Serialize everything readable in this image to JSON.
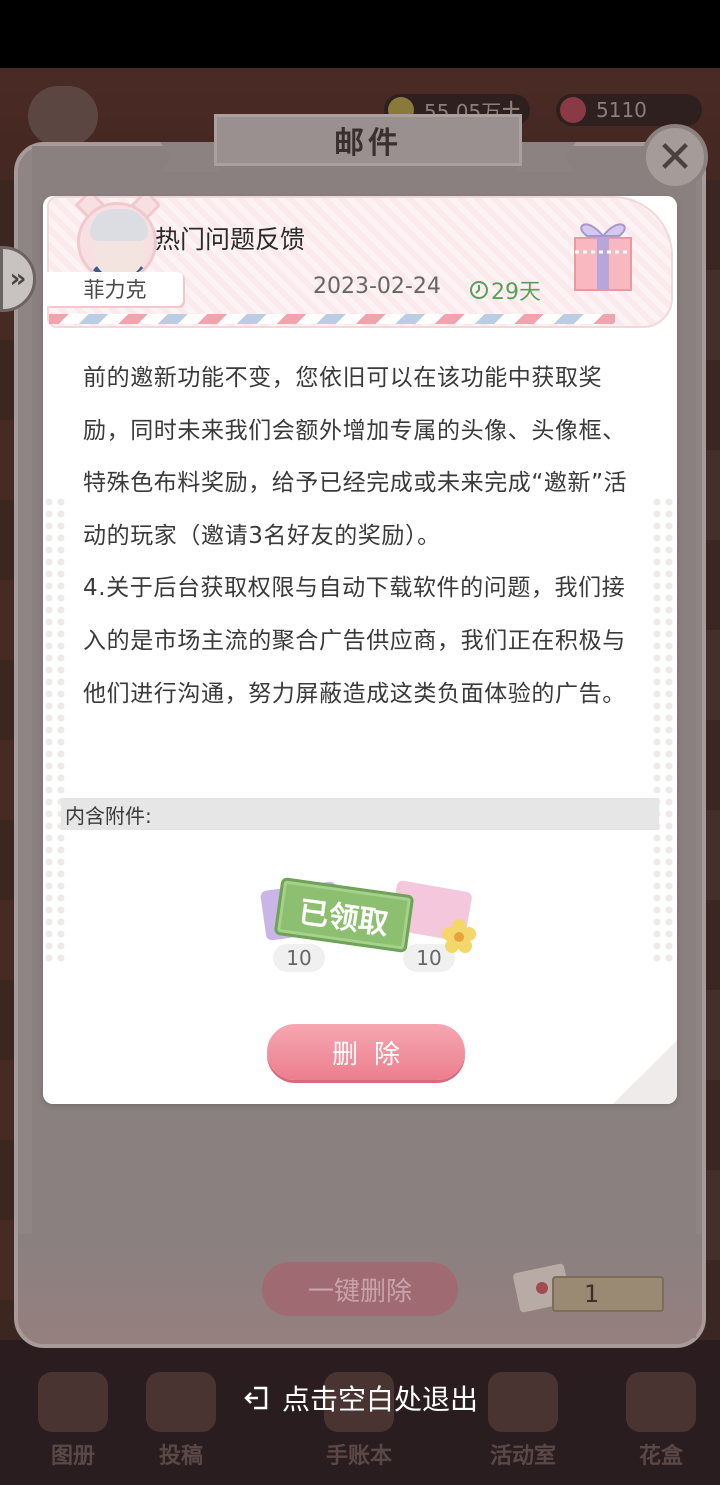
{
  "hud": {
    "currency_1": "55.05万",
    "currency_2": "5110"
  },
  "mail_window": {
    "title": "邮件",
    "close_symbol": "✕",
    "side_tab_symbol": "»",
    "delete_all_label": "一键删除",
    "mail_count": "1"
  },
  "mail": {
    "sender": "菲力克",
    "subject": "热门问题反馈",
    "date": "2023-02-24",
    "expires_in": "29天",
    "body": [
      "前的邀新功能不变，您依旧可以在该功能中获取奖励，同时未来我们会额外增加专属的头像、头像框、特殊色布料奖励，给予已经完成或未来完成“邀新”活动的玩家（邀请3名好友的奖励）。",
      "4.关于后台获取权限与自动下载软件的问题，我们接入的是市场主流的聚合广告供应商，我们正在积极与他们进行沟通，努力屏蔽造成这类负面体验的广告。"
    ],
    "attachments_label": "内含附件:",
    "attachments": [
      {
        "icon": "coupon-icon",
        "qty": "10",
        "color": "#c9b6e6"
      },
      {
        "icon": "diy-ticket-icon",
        "qty": "10",
        "color": "#f5c7dd"
      }
    ],
    "claimed_stamp": "已领取",
    "delete_label": "删除"
  },
  "bottom_menu": [
    {
      "label": "图册",
      "icon": "album-icon"
    },
    {
      "label": "投稿",
      "icon": "submit-icon"
    },
    {
      "label": "手账本",
      "icon": "notebook-icon"
    },
    {
      "label": "活动室",
      "icon": "activity-room-icon"
    },
    {
      "label": "花盒",
      "icon": "flower-box-icon"
    }
  ],
  "exit_hint": "点击空白处退出",
  "colors": {
    "accent_pink": "#ec7e8e",
    "expire_green": "#5aa05a",
    "stamp_green": "#8cc070"
  }
}
